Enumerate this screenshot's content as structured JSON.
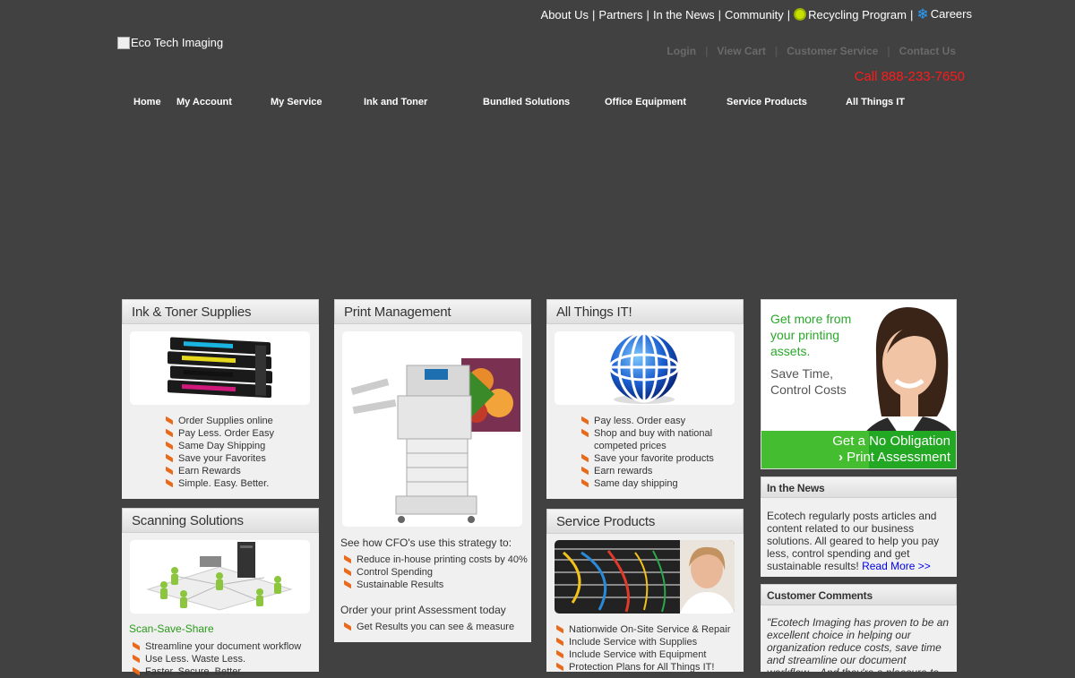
{
  "top_links": {
    "about": "About Us",
    "partners": "Partners",
    "news": "In the News",
    "community": "Community",
    "recycling": "Recycling Program",
    "careers": "Careers",
    "separator": "|"
  },
  "logo_alt": "Eco Tech Imaging",
  "account_links": {
    "login": "Login",
    "cart": "View Cart",
    "service": "Customer Service",
    "contact": "Contact Us",
    "separator": "|"
  },
  "phone": "Call 888-233-7650",
  "nav": [
    "Home",
    "My Account",
    "My Service",
    "Ink and Toner",
    "Bundled Solutions",
    "Office Equipment",
    "Service Products",
    "All Things IT"
  ],
  "ink_panel": {
    "title": "Ink & Toner Supplies",
    "items": [
      "Order Supplies online",
      "Pay Less. Order Easy",
      "Same Day Shipping",
      "Save your Favorites",
      "Earn Rewards",
      "Simple. Easy. Better."
    ]
  },
  "scan_panel": {
    "title": "Scanning Solutions",
    "tagline": "Scan-Save-Share",
    "items": [
      "Streamline your document workflow",
      "Use Less. Waste Less.",
      "Faster. Secure. Better."
    ]
  },
  "print_panel": {
    "title": "Print Management",
    "cfo_text": "See how CFO's use this strategy to:",
    "items": [
      "Reduce in-house printing costs by 40%",
      "Control Spending",
      "Sustainable Results"
    ],
    "order_text": "Order your print Assessment today",
    "order_items": [
      "Get Results you can see & measure"
    ]
  },
  "it_panel": {
    "title": "All Things IT!",
    "items": [
      "Pay less. Order easy",
      "Shop and buy with national competed prices",
      "Save your favorite products",
      "Earn rewards",
      "Same day shipping"
    ]
  },
  "service_panel": {
    "title": "Service Products",
    "items": [
      "Nationwide On-Site Service & Repair",
      "Include Service with Supplies",
      "Include Service with Equipment",
      "Protection Plans for All Things IT!"
    ]
  },
  "promo": {
    "line1": "Get more from",
    "line2": "your printing",
    "line3": "assets.",
    "line4": "Save Time,",
    "line5": "Control Costs",
    "cta1": "Get a No Obligation",
    "cta2": "Print Assessment"
  },
  "news_panel": {
    "title": "In the News",
    "body": "Ecotech regularly posts articles and content related to our business solutions. All geared to help you pay less, control spending and get sustainable results!",
    "link": "Read More >>"
  },
  "comments_panel": {
    "title": "Customer Comments",
    "quote": "\"Ecotech Imaging has proven to be an excellent choice in helping our organization reduce costs, save time and streamline our document workflow... And they're a pleasure to"
  },
  "colors": {
    "background": "#414141",
    "phone": "#ff1a1a",
    "bullet": "#e86a1a",
    "green": "#2a9a1a",
    "link": "#0000ee"
  }
}
